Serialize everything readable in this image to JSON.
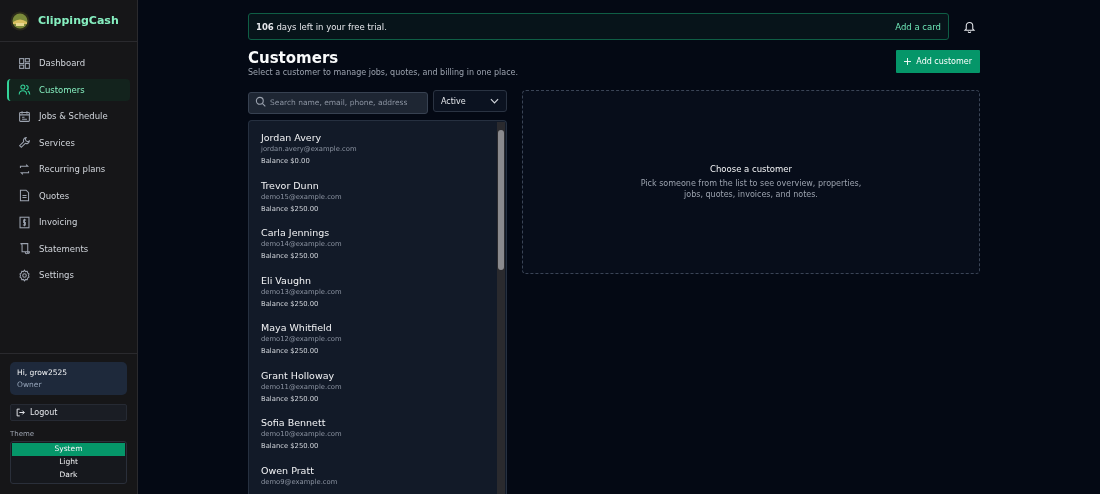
{
  "brand": {
    "name": "ClippingCash"
  },
  "nav": [
    {
      "label": "Dashboard",
      "selected": false
    },
    {
      "label": "Customers",
      "selected": true
    },
    {
      "label": "Jobs & Schedule",
      "selected": false
    },
    {
      "label": "Services",
      "selected": false
    },
    {
      "label": "Recurring plans",
      "selected": false
    },
    {
      "label": "Quotes",
      "selected": false
    },
    {
      "label": "Invoicing",
      "selected": false
    },
    {
      "label": "Statements",
      "selected": false
    },
    {
      "label": "Settings",
      "selected": false
    }
  ],
  "user": {
    "greeting": "Hi, grow2525",
    "role": "Owner"
  },
  "logout": "Logout",
  "theme": {
    "label": "Theme",
    "options": [
      {
        "label": "System",
        "selected": true
      },
      {
        "label": "Light",
        "selected": false
      },
      {
        "label": "Dark",
        "selected": false
      }
    ]
  },
  "trial": {
    "text": "**106** days left in your free trial.",
    "action": "Add a card"
  },
  "page": {
    "title": "Customers",
    "subtitle": "Select a customer to manage jobs, quotes, and billing in one place.",
    "add_button": "Add customer"
  },
  "search": {
    "placeholder": "Search name, email, phone, address"
  },
  "filter": {
    "value": "Active"
  },
  "customers": [
    {
      "name": "Jordan Avery",
      "email": "jordan.avery@example.com",
      "balance": "Balance $0.00"
    },
    {
      "name": "Trevor Dunn",
      "email": "demo15@example.com",
      "balance": "Balance $250.00"
    },
    {
      "name": "Carla Jennings",
      "email": "demo14@example.com",
      "balance": "Balance $250.00"
    },
    {
      "name": "Eli Vaughn",
      "email": "demo13@example.com",
      "balance": "Balance $250.00"
    },
    {
      "name": "Maya Whitfield",
      "email": "demo12@example.com",
      "balance": "Balance $250.00"
    },
    {
      "name": "Grant Holloway",
      "email": "demo11@example.com",
      "balance": "Balance $250.00"
    },
    {
      "name": "Sofia Bennett",
      "email": "demo10@example.com",
      "balance": "Balance $250.00"
    },
    {
      "name": "Owen Pratt",
      "email": "demo9@example.com"
    }
  ],
  "empty": {
    "title": "Choose a customer",
    "text": "Pick someone from the list to see overview, properties, jobs, quotes, invoices, and notes."
  }
}
